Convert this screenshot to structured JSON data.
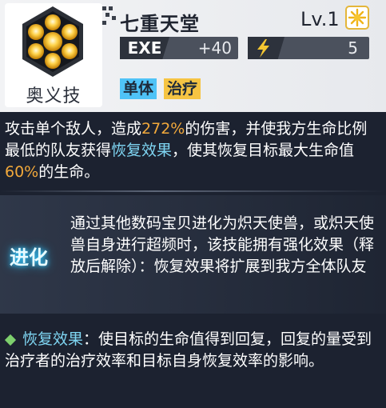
{
  "skill": {
    "name": "七重天堂",
    "type_label": "奥义技",
    "level": "Lv.1",
    "exe_label": "EXE",
    "exe_value": "+40",
    "cost_value": "5",
    "tags": [
      "单体",
      "治疗"
    ]
  },
  "description": {
    "p1": "攻击单个敌人，造成",
    "hl1": "272%",
    "p2": "的伤害，并使我方生命比例最低的队友获得",
    "hl2": "恢复效果",
    "p3": "，使其恢复目标最大生命值",
    "hl3": "60%",
    "p4": "的生命。"
  },
  "evolution": {
    "icon_text": "进化",
    "text": "通过其他数码宝贝进化为炽天使兽，或炽天使兽自身进行超频时，该技能拥有强化效果（释放后解除）：恢复效果将扩展到我方全体队友"
  },
  "footnote": {
    "term": "恢复效果",
    "text": "：使目标的生命值得到回复，回复的量受到治疗者的治疗效率和目标自身恢复效率的影响。"
  },
  "colors": {
    "highlight_orange": "#f2a93b",
    "highlight_cyan": "#7fd6f3",
    "tag_target": "#4fc3f7",
    "tag_effect": "#f6c443",
    "bullet_green": "#7ed06d"
  },
  "icons": {
    "skill": "seven-orb-hexagon-icon",
    "level_badge": "star-sun-badge-icon",
    "cost": "lightning-bolt-icon",
    "bullet": "diamond-bullet-icon"
  }
}
